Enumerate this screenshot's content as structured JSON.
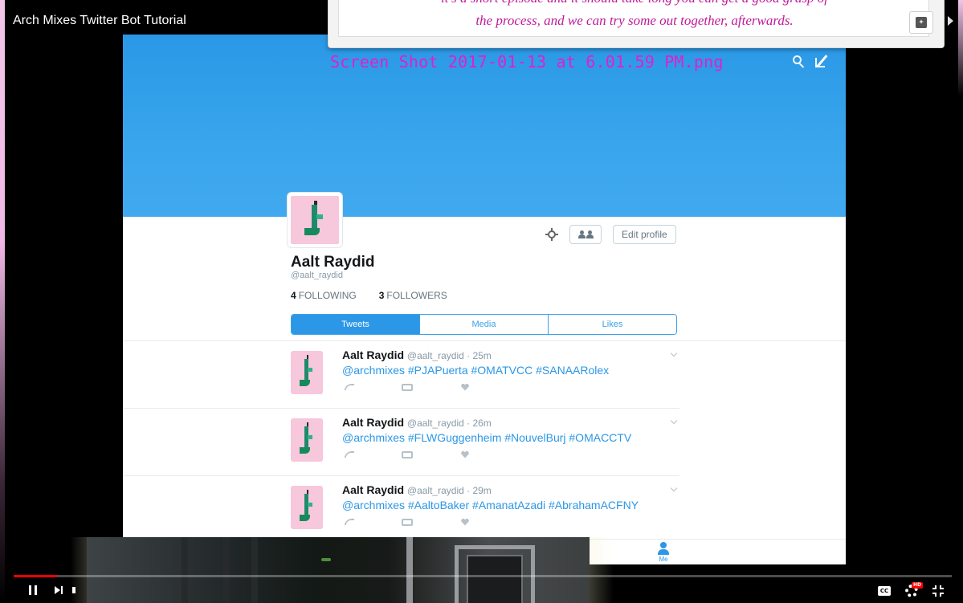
{
  "player": {
    "video_title": "Arch Mixes Twitter Bot Tutorial",
    "progress_fraction": 0.046,
    "buttons": {
      "play_pause": "pause-icon",
      "next": "next-icon",
      "volume": "volume-icon",
      "captions": "cc-icon",
      "captions_label": "CC",
      "settings": "settings-icon",
      "hd_badge": "HD",
      "exit_fullscreen": "exit-fullscreen-icon"
    }
  },
  "popup": {
    "line1": "it's a short episode and it should take long you can get a good grasp of",
    "line2": "the process, and we can try some out together, afterwards."
  },
  "screenshot": {
    "filename": "Screen Shot 2017-01-13 at 6.01.59 PM.png"
  },
  "profile": {
    "name": "Aalt Raydid",
    "handle": "@aalt_raydid",
    "following_count": "4",
    "following_label": "FOLLOWING",
    "followers_count": "3",
    "followers_label": "FOLLOWERS",
    "edit_profile_label": "Edit profile"
  },
  "tabs": [
    {
      "label": "Tweets",
      "active": true
    },
    {
      "label": "Media",
      "active": false
    },
    {
      "label": "Likes",
      "active": false
    }
  ],
  "tweets": [
    {
      "name": "Aalt Raydid",
      "meta": "@aalt_raydid · 25m",
      "text": "@archmixes #PJAPuerta #OMATVCC #SANAARolex"
    },
    {
      "name": "Aalt Raydid",
      "meta": "@aalt_raydid · 26m",
      "text": "@archmixes #FLWGuggenheim #NouvelBurj #OMACCTV"
    },
    {
      "name": "Aalt Raydid",
      "meta": "@aalt_raydid · 29m",
      "text": "@archmixes #AaltoBaker #AmanatAzadi #AbrahamACFNY"
    }
  ],
  "bottom_nav": {
    "me_label": "Me"
  },
  "colors": {
    "twitter_blue": "#2b97e6",
    "popup_text": "#c01a9a",
    "filename_text": "#e21ed0",
    "progress_red": "#ff0000"
  }
}
